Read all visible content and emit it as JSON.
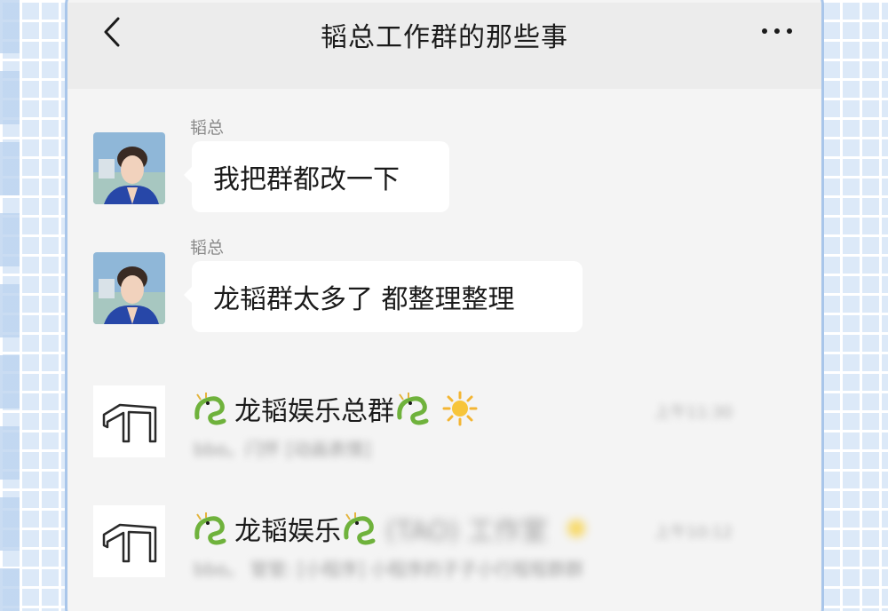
{
  "header": {
    "title": "韬总工作群的那些事",
    "back_icon": "chevron-left-icon",
    "more_icon": "more-dots-icon"
  },
  "messages": [
    {
      "sender": "韬总",
      "text": "我把群都改一下"
    },
    {
      "sender": "韬总",
      "text": "龙韬群太多了 都整理整理"
    }
  ],
  "chats": [
    {
      "name": "龙韬娱乐总群",
      "icons": [
        "dragon-emoji-icon",
        "dragon-emoji-icon",
        "sun-emoji-icon"
      ],
      "preview": "bbo。闩怀 [动画表情]",
      "time": "上午11:30"
    },
    {
      "name": "龙韬娱乐",
      "name_blurred": "(TAO) 工作室",
      "icons": [
        "dragon-emoji-icon",
        "dragon-emoji-icon",
        "sun-emoji-icon"
      ],
      "preview": "bbo。 管管: [小程序] 小程序的子子小行程程群群",
      "time": "上午10:12"
    }
  ],
  "colors": {
    "background": "#dce9f8",
    "phone_border": "#a9c6ea",
    "header_bg": "#ececec",
    "chat_bg": "#f4f4f4",
    "bubble_bg": "#ffffff"
  }
}
